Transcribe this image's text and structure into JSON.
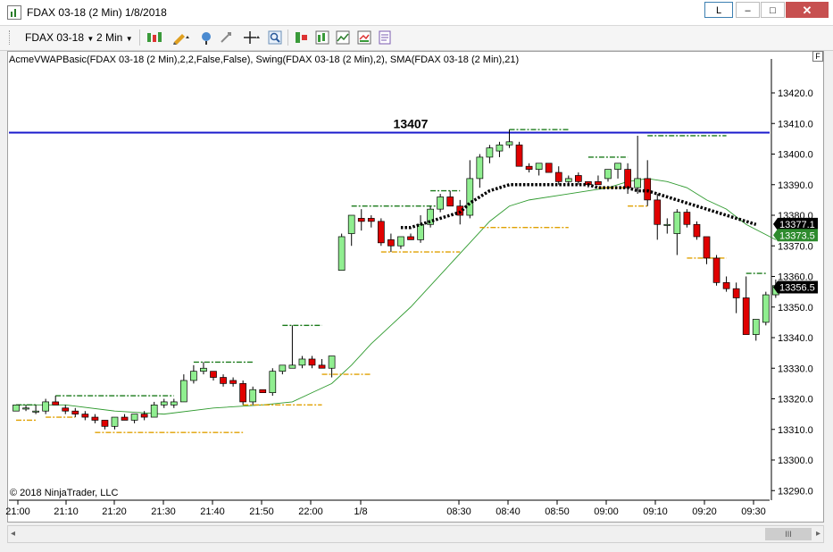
{
  "window": {
    "title": "FDAX 03-18 (2 Min)  1/8/2018",
    "link_label": "L",
    "minimize_label": "–",
    "maximize_label": "□",
    "close_label": "✕"
  },
  "toolbar": {
    "instrument": "FDAX 03-18",
    "interval": "2 Min",
    "icons": [
      "bars-type-icon",
      "drawing-pencil-icon",
      "crosshair-pin-icon",
      "pointer-icon",
      "crosshair-icon",
      "zoom-icon",
      "strategies-icon",
      "indicators-icon",
      "chart-trader-icon",
      "properties-icon"
    ]
  },
  "chart": {
    "indicator_label": "AcmeVWAPBasic(FDAX 03-18 (2 Min),2,2,False,False), Swing(FDAX 03-18 (2 Min),2), SMA(FDAX 03-18 (2 Min),21)",
    "copyright": "© 2018 NinjaTrader, LLC",
    "f_label": "F",
    "hline_label": "13407",
    "hline_value": 13407,
    "hline_color": "#1a1acc",
    "up_color": "#90ee90",
    "down_color": "#e00000",
    "y_ticks": [
      "13290.0",
      "13300.0",
      "13310.0",
      "13320.0",
      "13330.0",
      "13340.0",
      "13350.0",
      "13360.0",
      "13370.0",
      "13380.0",
      "13390.0",
      "13400.0",
      "13410.0",
      "13420.0"
    ],
    "x_ticks": [
      "21:00",
      "21:10",
      "21:20",
      "21:30",
      "21:40",
      "21:50",
      "22:00",
      "1/8",
      "08:30",
      "08:40",
      "08:50",
      "09:00",
      "09:10",
      "09:20",
      "09:30"
    ],
    "price_tags": [
      {
        "text": "13377.1",
        "value": 13377.1,
        "bg": "#000000"
      },
      {
        "text": "13373.5",
        "value": 13373.5,
        "bg": "#2e8b2e"
      },
      {
        "text": "13356.5",
        "value": 13356.5,
        "bg": "#000000"
      }
    ]
  },
  "scrollbar": {
    "thumb_label": "III",
    "left_arrow": "◂",
    "right_arrow": "▸"
  },
  "chart_data": {
    "type": "candlestick",
    "ylim": [
      13288,
      13427
    ],
    "candles": [
      {
        "o": 13316,
        "h": 13318,
        "l": 13316,
        "c": 13318
      },
      {
        "o": 13317,
        "h": 13318,
        "l": 13316,
        "c": 13317
      },
      {
        "o": 13316,
        "h": 13318,
        "l": 13315,
        "c": 13316
      },
      {
        "o": 13316,
        "h": 13320,
        "l": 13315,
        "c": 13319
      },
      {
        "o": 13319,
        "h": 13321,
        "l": 13318,
        "c": 13318
      },
      {
        "o": 13317,
        "h": 13318,
        "l": 13315,
        "c": 13316
      },
      {
        "o": 13316,
        "h": 13317,
        "l": 13314,
        "c": 13315
      },
      {
        "o": 13315,
        "h": 13316,
        "l": 13313,
        "c": 13314
      },
      {
        "o": 13314,
        "h": 13315,
        "l": 13312,
        "c": 13313
      },
      {
        "o": 13313,
        "h": 13313,
        "l": 13310,
        "c": 13311
      },
      {
        "o": 13311,
        "h": 13314,
        "l": 13310,
        "c": 13314
      },
      {
        "o": 13314,
        "h": 13315,
        "l": 13313,
        "c": 13313
      },
      {
        "o": 13313,
        "h": 13315,
        "l": 13312,
        "c": 13315
      },
      {
        "o": 13315,
        "h": 13316,
        "l": 13313,
        "c": 13314
      },
      {
        "o": 13314,
        "h": 13319,
        "l": 13314,
        "c": 13318
      },
      {
        "o": 13318,
        "h": 13320,
        "l": 13317,
        "c": 13319
      },
      {
        "o": 13318,
        "h": 13320,
        "l": 13317,
        "c": 13319
      },
      {
        "o": 13319,
        "h": 13328,
        "l": 13319,
        "c": 13326
      },
      {
        "o": 13326,
        "h": 13331,
        "l": 13325,
        "c": 13329
      },
      {
        "o": 13329,
        "h": 13332,
        "l": 13328,
        "c": 13330
      },
      {
        "o": 13329,
        "h": 13329,
        "l": 13326,
        "c": 13327
      },
      {
        "o": 13327,
        "h": 13328,
        "l": 13324,
        "c": 13325
      },
      {
        "o": 13326,
        "h": 13327,
        "l": 13324,
        "c": 13325
      },
      {
        "o": 13325,
        "h": 13326,
        "l": 13318,
        "c": 13319
      },
      {
        "o": 13319,
        "h": 13324,
        "l": 13318,
        "c": 13323
      },
      {
        "o": 13323,
        "h": 13323,
        "l": 13322,
        "c": 13322
      },
      {
        "o": 13322,
        "h": 13330,
        "l": 13321,
        "c": 13329
      },
      {
        "o": 13329,
        "h": 13331,
        "l": 13328,
        "c": 13331
      },
      {
        "o": 13330,
        "h": 13344,
        "l": 13330,
        "c": 13331
      },
      {
        "o": 13331,
        "h": 13334,
        "l": 13330,
        "c": 13333
      },
      {
        "o": 13333,
        "h": 13334,
        "l": 13330,
        "c": 13331
      },
      {
        "o": 13331,
        "h": 13333,
        "l": 13330,
        "c": 13330
      },
      {
        "o": 13330,
        "h": 13334,
        "l": 13327,
        "c": 13334
      },
      {
        "o": 13362,
        "h": 13374,
        "l": 13362,
        "c": 13373
      },
      {
        "o": 13374,
        "h": 13380,
        "l": 13370,
        "c": 13380
      },
      {
        "o": 13379,
        "h": 13382,
        "l": 13375,
        "c": 13378
      },
      {
        "o": 13379,
        "h": 13380,
        "l": 13376,
        "c": 13378
      },
      {
        "o": 13378,
        "h": 13379,
        "l": 13370,
        "c": 13371
      },
      {
        "o": 13372,
        "h": 13374,
        "l": 13368,
        "c": 13370
      },
      {
        "o": 13370,
        "h": 13373,
        "l": 13369,
        "c": 13373
      },
      {
        "o": 13373,
        "h": 13374,
        "l": 13372,
        "c": 13372
      },
      {
        "o": 13372,
        "h": 13380,
        "l": 13371,
        "c": 13377
      },
      {
        "o": 13377,
        "h": 13383,
        "l": 13376,
        "c": 13382
      },
      {
        "o": 13382,
        "h": 13387,
        "l": 13381,
        "c": 13386
      },
      {
        "o": 13386,
        "h": 13388,
        "l": 13383,
        "c": 13383
      },
      {
        "o": 13383,
        "h": 13385,
        "l": 13377,
        "c": 13380
      },
      {
        "o": 13380,
        "h": 13398,
        "l": 13379,
        "c": 13392
      },
      {
        "o": 13392,
        "h": 13400,
        "l": 13389,
        "c": 13399
      },
      {
        "o": 13399,
        "h": 13403,
        "l": 13397,
        "c": 13402
      },
      {
        "o": 13401,
        "h": 13404,
        "l": 13399,
        "c": 13403
      },
      {
        "o": 13403,
        "h": 13408,
        "l": 13402,
        "c": 13404
      },
      {
        "o": 13403,
        "h": 13404,
        "l": 13396,
        "c": 13396
      },
      {
        "o": 13396,
        "h": 13397,
        "l": 13394,
        "c": 13395
      },
      {
        "o": 13395,
        "h": 13397,
        "l": 13393,
        "c": 13397
      },
      {
        "o": 13397,
        "h": 13397,
        "l": 13394,
        "c": 13394
      },
      {
        "o": 13394,
        "h": 13396,
        "l": 13390,
        "c": 13391
      },
      {
        "o": 13391,
        "h": 13393,
        "l": 13390,
        "c": 13392
      },
      {
        "o": 13393,
        "h": 13394,
        "l": 13390,
        "c": 13391
      },
      {
        "o": 13391,
        "h": 13391,
        "l": 13389,
        "c": 13390
      },
      {
        "o": 13391,
        "h": 13393,
        "l": 13390,
        "c": 13390
      },
      {
        "o": 13392,
        "h": 13395,
        "l": 13391,
        "c": 13395
      },
      {
        "o": 13395,
        "h": 13397,
        "l": 13392,
        "c": 13397
      },
      {
        "o": 13395,
        "h": 13397,
        "l": 13387,
        "c": 13389
      },
      {
        "o": 13389,
        "h": 13406,
        "l": 13387,
        "c": 13392
      },
      {
        "o": 13392,
        "h": 13398,
        "l": 13383,
        "c": 13385
      },
      {
        "o": 13385,
        "h": 13387,
        "l": 13372,
        "c": 13377
      },
      {
        "o": 13377,
        "h": 13379,
        "l": 13374,
        "c": 13377
      },
      {
        "o": 13374,
        "h": 13382,
        "l": 13367,
        "c": 13381
      },
      {
        "o": 13381,
        "h": 13382,
        "l": 13376,
        "c": 13377
      },
      {
        "o": 13377,
        "h": 13378,
        "l": 13372,
        "c": 13373
      },
      {
        "o": 13373,
        "h": 13373,
        "l": 13364,
        "c": 13366
      },
      {
        "o": 13366,
        "h": 13367,
        "l": 13357,
        "c": 13358
      },
      {
        "o": 13358,
        "h": 13360,
        "l": 13355,
        "c": 13356
      },
      {
        "o": 13356,
        "h": 13358,
        "l": 13348,
        "c": 13353
      },
      {
        "o": 13353,
        "h": 13360,
        "l": 13349,
        "c": 13341
      },
      {
        "o": 13341,
        "h": 13346,
        "l": 13339,
        "c": 13346
      },
      {
        "o": 13345,
        "h": 13355,
        "l": 13344,
        "c": 13354
      },
      {
        "o": 13354,
        "h": 13359,
        "l": 13353,
        "c": 13357
      }
    ],
    "vwap": [
      {
        "i": 39,
        "v": 13376
      },
      {
        "i": 40,
        "v": 13376
      },
      {
        "i": 41,
        "v": 13377
      },
      {
        "i": 42,
        "v": 13378
      },
      {
        "i": 43,
        "v": 13379
      },
      {
        "i": 44,
        "v": 13380
      },
      {
        "i": 45,
        "v": 13381
      },
      {
        "i": 46,
        "v": 13384
      },
      {
        "i": 47,
        "v": 13386
      },
      {
        "i": 48,
        "v": 13388
      },
      {
        "i": 49,
        "v": 13389
      },
      {
        "i": 50,
        "v": 13390
      },
      {
        "i": 51,
        "v": 13390
      },
      {
        "i": 52,
        "v": 13390
      },
      {
        "i": 53,
        "v": 13390
      },
      {
        "i": 54,
        "v": 13390
      },
      {
        "i": 55,
        "v": 13390
      },
      {
        "i": 56,
        "v": 13390
      },
      {
        "i": 57,
        "v": 13390
      },
      {
        "i": 58,
        "v": 13390
      },
      {
        "i": 59,
        "v": 13389
      },
      {
        "i": 60,
        "v": 13389
      },
      {
        "i": 61,
        "v": 13389
      },
      {
        "i": 62,
        "v": 13389
      },
      {
        "i": 63,
        "v": 13388
      },
      {
        "i": 64,
        "v": 13388
      },
      {
        "i": 65,
        "v": 13387
      },
      {
        "i": 66,
        "v": 13386
      },
      {
        "i": 67,
        "v": 13385
      },
      {
        "i": 68,
        "v": 13384
      },
      {
        "i": 69,
        "v": 13383
      },
      {
        "i": 70,
        "v": 13382
      },
      {
        "i": 71,
        "v": 13381
      },
      {
        "i": 72,
        "v": 13380
      },
      {
        "i": 73,
        "v": 13379
      },
      {
        "i": 74,
        "v": 13378
      },
      {
        "i": 75,
        "v": 13377
      }
    ],
    "sma": [
      {
        "i": 0,
        "v": 13318
      },
      {
        "i": 5,
        "v": 13318
      },
      {
        "i": 10,
        "v": 13316
      },
      {
        "i": 15,
        "v": 13315
      },
      {
        "i": 20,
        "v": 13317
      },
      {
        "i": 25,
        "v": 13318
      },
      {
        "i": 28,
        "v": 13319
      },
      {
        "i": 30,
        "v": 13322
      },
      {
        "i": 32,
        "v": 13325
      },
      {
        "i": 34,
        "v": 13331
      },
      {
        "i": 36,
        "v": 13338
      },
      {
        "i": 38,
        "v": 13344
      },
      {
        "i": 40,
        "v": 13350
      },
      {
        "i": 42,
        "v": 13357
      },
      {
        "i": 44,
        "v": 13364
      },
      {
        "i": 46,
        "v": 13371
      },
      {
        "i": 48,
        "v": 13378
      },
      {
        "i": 50,
        "v": 13383
      },
      {
        "i": 52,
        "v": 13385
      },
      {
        "i": 56,
        "v": 13387
      },
      {
        "i": 60,
        "v": 13389
      },
      {
        "i": 62,
        "v": 13391
      },
      {
        "i": 64,
        "v": 13392
      },
      {
        "i": 66,
        "v": 13391
      },
      {
        "i": 68,
        "v": 13389
      },
      {
        "i": 70,
        "v": 13385
      },
      {
        "i": 72,
        "v": 13382
      },
      {
        "i": 74,
        "v": 13377
      },
      {
        "i": 77,
        "v": 13372
      }
    ],
    "swing_high": [
      {
        "from": 0,
        "to": 2,
        "v": 13318
      },
      {
        "from": 4,
        "to": 16,
        "v": 13321
      },
      {
        "from": 18,
        "to": 24,
        "v": 13332
      },
      {
        "from": 27,
        "to": 31,
        "v": 13344
      },
      {
        "from": 34,
        "to": 43,
        "v": 13383
      },
      {
        "from": 42,
        "to": 45,
        "v": 13388
      },
      {
        "from": 50,
        "to": 56,
        "v": 13408
      },
      {
        "from": 58,
        "to": 62,
        "v": 13399
      },
      {
        "from": 64,
        "to": 72,
        "v": 13406
      },
      {
        "from": 74,
        "to": 76,
        "v": 13361
      }
    ],
    "swing_low": [
      {
        "from": 0,
        "to": 2,
        "v": 13313
      },
      {
        "from": 3,
        "to": 6,
        "v": 13314
      },
      {
        "from": 8,
        "to": 23,
        "v": 13309
      },
      {
        "from": 23,
        "to": 31,
        "v": 13318
      },
      {
        "from": 31,
        "to": 36,
        "v": 13328
      },
      {
        "from": 37,
        "to": 45,
        "v": 13368
      },
      {
        "from": 47,
        "to": 56,
        "v": 13376
      },
      {
        "from": 59,
        "to": 62,
        "v": 13389
      },
      {
        "from": 62,
        "to": 64,
        "v": 13383
      },
      {
        "from": 68,
        "to": 72,
        "v": 13366
      }
    ]
  }
}
